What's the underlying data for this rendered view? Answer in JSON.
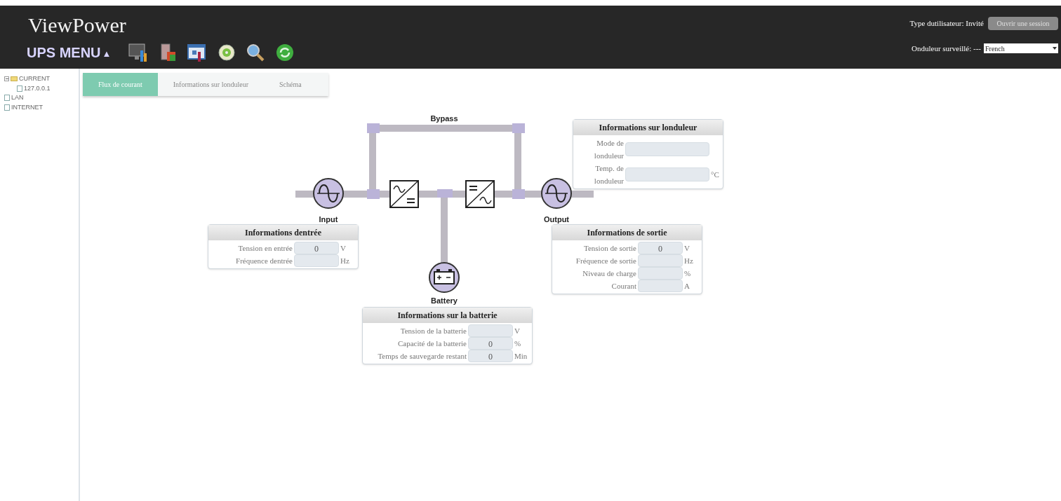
{
  "header": {
    "title": "ViewPower",
    "menu_label": "UPS MENU",
    "menu_arrow": "▲",
    "user_type": "Type dutilisateur: Invité",
    "login_button": "Ouvrir une session",
    "monitored_label": "Onduleur surveillé: ---",
    "language": "French"
  },
  "tree": [
    {
      "label": "CURRENT",
      "expanded": true,
      "children": [
        {
          "label": "127.0.0.1"
        }
      ]
    },
    {
      "label": "LAN"
    },
    {
      "label": "INTERNET"
    }
  ],
  "tabs": [
    {
      "label": "Flux de courant",
      "selected": true
    },
    {
      "label": "Informations sur londuleur",
      "selected": false
    },
    {
      "label": "Schéma",
      "selected": false
    }
  ],
  "diagram": {
    "bypass": "Bypass",
    "input": "Input",
    "output": "Output",
    "battery": "Battery"
  },
  "panels": [
    {
      "title": "Informations sur londuleur",
      "rows": [
        {
          "label": "Mode de londuleur"
        },
        {
          "label": "Temp. de londuleur",
          "unit": "°C"
        }
      ]
    },
    {
      "title": "Informations dentrée",
      "rows": [
        {
          "label": "Tension en entrée",
          "value": "0",
          "unit": "V"
        },
        {
          "label": "Fréquence dentrée",
          "unit": "Hz"
        }
      ]
    },
    {
      "title": "Informations de sortie",
      "rows": [
        {
          "label": "Tension de sortie",
          "value": "0",
          "unit": "V"
        },
        {
          "label": "Fréquence de sortie",
          "unit": "Hz"
        },
        {
          "label": "Niveau de charge",
          "unit": "%"
        },
        {
          "label": "Courant",
          "unit": "A"
        }
      ]
    },
    {
      "title": "Informations sur la batterie",
      "rows": [
        {
          "label": "Tension de la batterie",
          "unit": "V"
        },
        {
          "label": "Capacité de la batterie",
          "value": "0",
          "unit": "%"
        },
        {
          "label": "Temps de sauvegarde restant",
          "value": "0",
          "unit": "Min"
        }
      ]
    }
  ]
}
